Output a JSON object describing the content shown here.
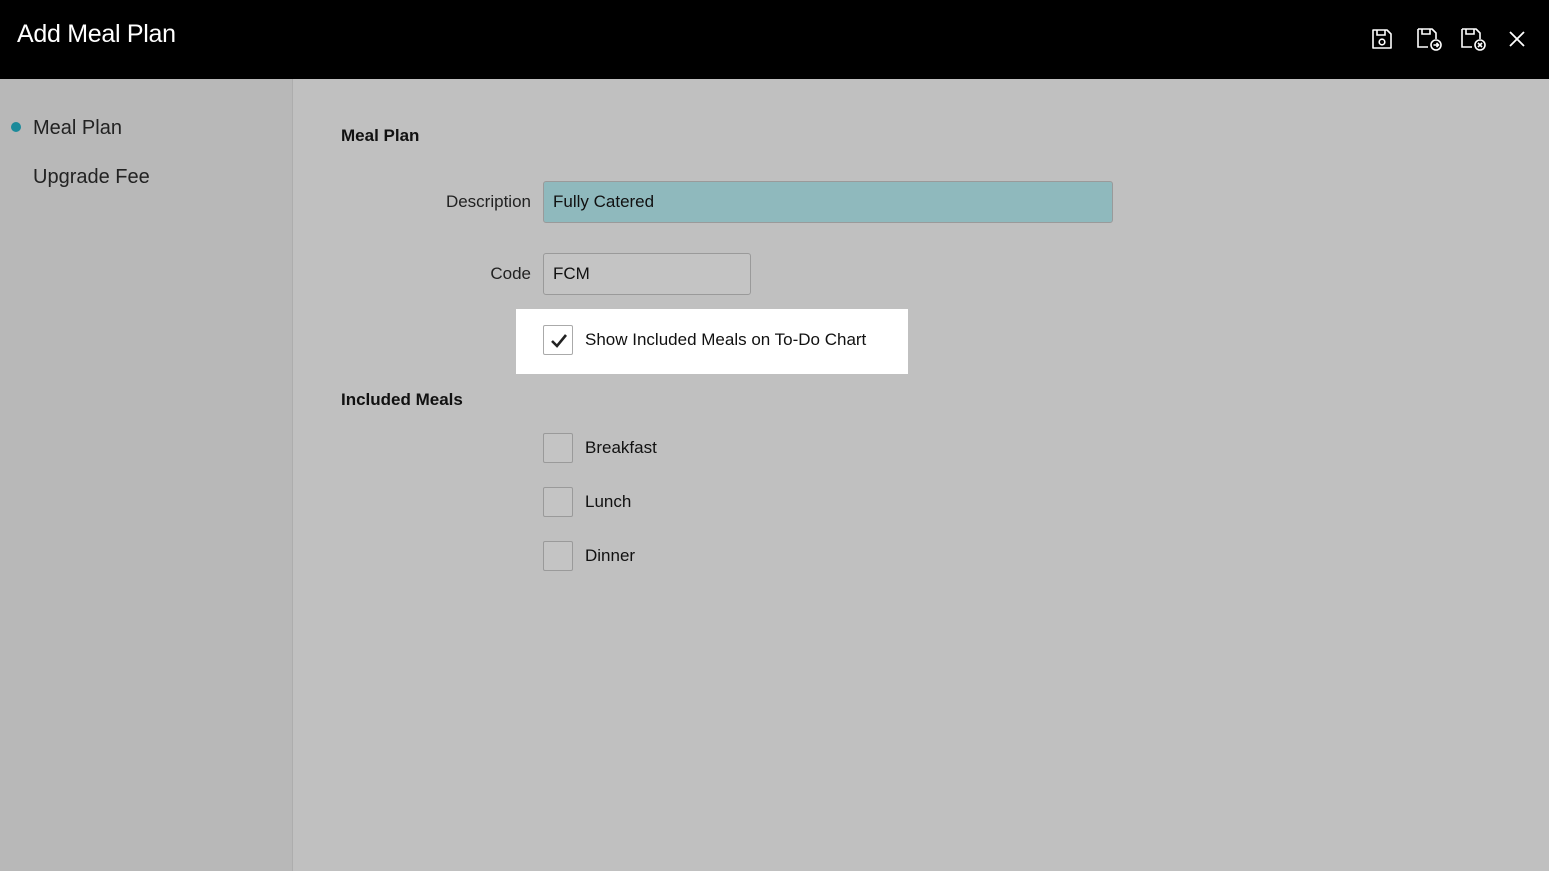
{
  "window": {
    "title": "Add Meal Plan"
  },
  "toolbar": {
    "icons": [
      "save-icon",
      "save-and-new-icon",
      "save-and-close-icon",
      "close-icon"
    ]
  },
  "sidebar": {
    "items": [
      {
        "label": "Meal Plan",
        "active": true
      },
      {
        "label": "Upgrade Fee",
        "active": false
      }
    ]
  },
  "form": {
    "section_title": "Meal Plan",
    "description": {
      "label": "Description",
      "value": "Fully Catered"
    },
    "code": {
      "label": "Code",
      "value": "FCM"
    },
    "show_meals": {
      "label": "Show Included Meals on To-Do Chart",
      "checked": true
    }
  },
  "included_meals": {
    "title": "Included Meals",
    "items": [
      {
        "label": "Breakfast",
        "checked": false
      },
      {
        "label": "Lunch",
        "checked": false
      },
      {
        "label": "Dinner",
        "checked": false
      }
    ]
  },
  "colors": {
    "accent": "#1b8a9a",
    "highlighted_input": "#8fb9bd",
    "titlebar": "#000000",
    "background": "#c0c0c0"
  }
}
